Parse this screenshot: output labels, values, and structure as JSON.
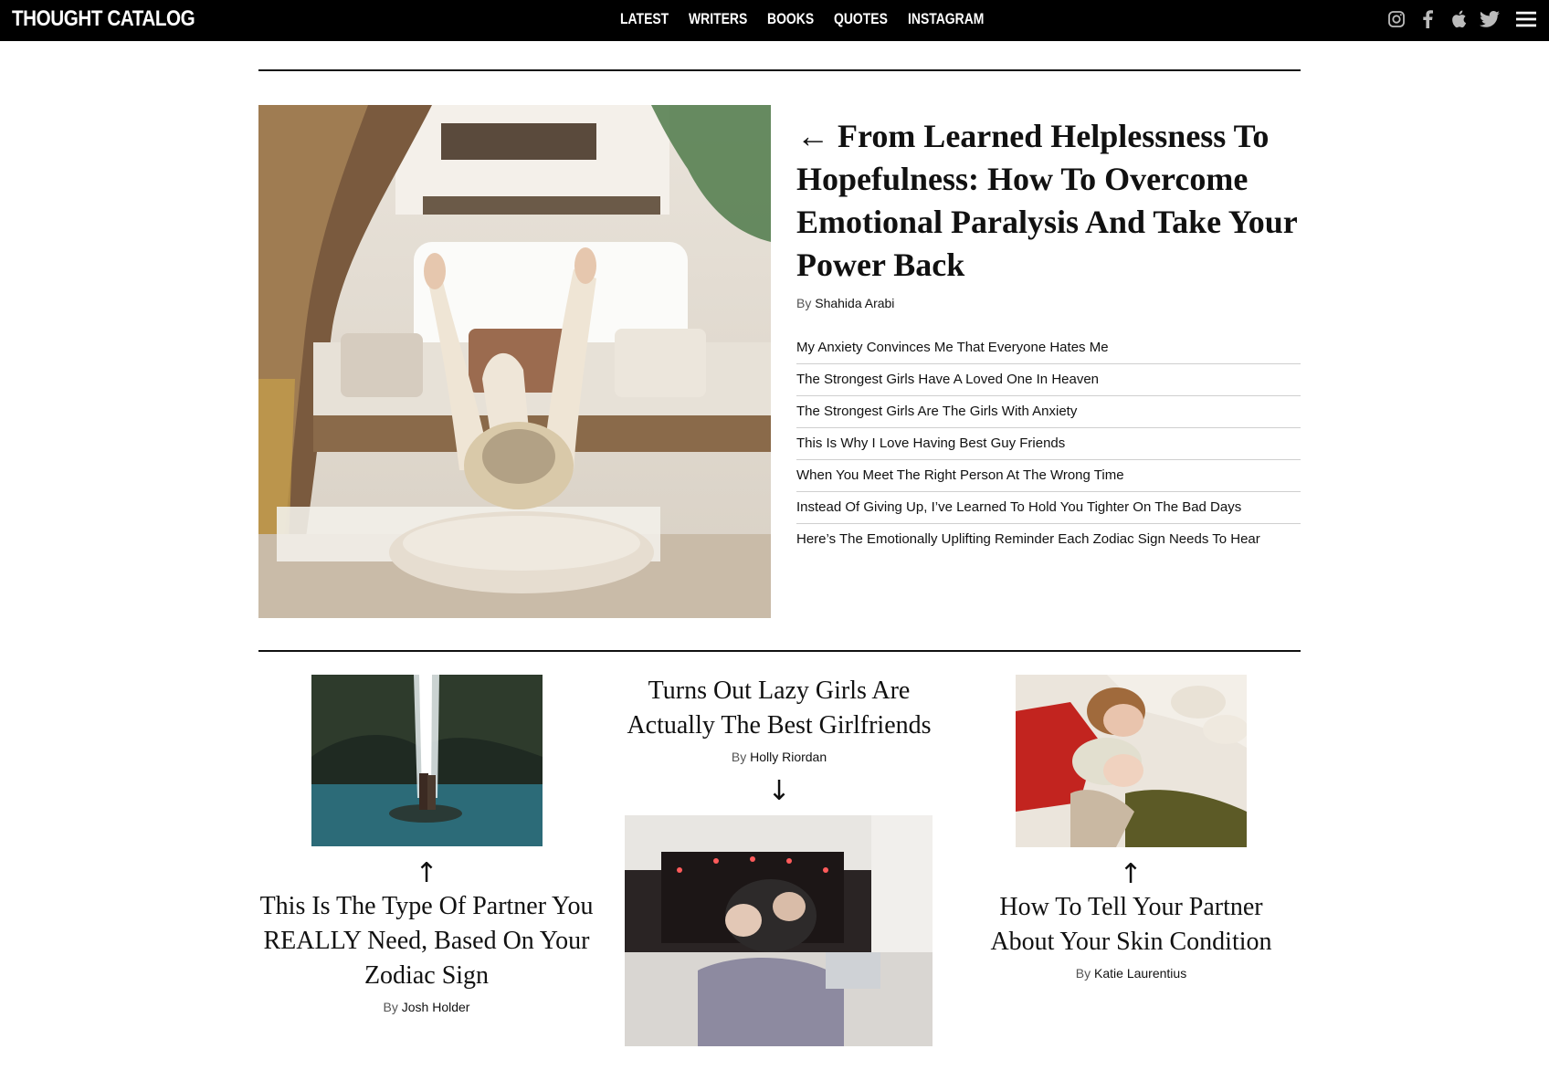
{
  "site": {
    "logo": "THOUGHT CATALOG"
  },
  "nav": {
    "items": [
      "LATEST",
      "WRITERS",
      "BOOKS",
      "QUOTES",
      "INSTAGRAM"
    ]
  },
  "social_icons": [
    "instagram-icon",
    "facebook-icon",
    "apple-icon",
    "twitter-icon",
    "menu-icon"
  ],
  "feature": {
    "arrow": "←",
    "title": "From Learned Helplessness To Hopefulness: How To Overcome Emotional Paralysis And Take Your Power Back",
    "by_label": "By",
    "author": "Shahida Arabi",
    "related": [
      "My Anxiety Convinces Me That Everyone Hates Me",
      "The Strongest Girls Have A Loved One In Heaven",
      "The Strongest Girls Are The Girls With Anxiety",
      "This Is Why I Love Having Best Guy Friends",
      "When You Meet The Right Person At The Wrong Time",
      "Instead Of Giving Up, I’ve Learned To Hold You Tighter On The Bad Days",
      "Here’s The Emotionally Uplifting Reminder Each Zodiac Sign Needs To Hear"
    ]
  },
  "cards": {
    "left": {
      "arrow": "↑",
      "title": "This Is The Type Of Partner You REALLY Need, Based On Your Zodiac Sign",
      "by_label": "By",
      "author": "Josh Holder"
    },
    "center": {
      "title": "Turns Out Lazy Girls Are Actually The Best Girlfriends",
      "by_label": "By",
      "author": "Holly Riordan",
      "arrow": "↓"
    },
    "right": {
      "arrow": "↑",
      "title": "How To Tell Your Partner About Your Skin Condition",
      "by_label": "By",
      "author": "Katie Laurentius"
    }
  }
}
